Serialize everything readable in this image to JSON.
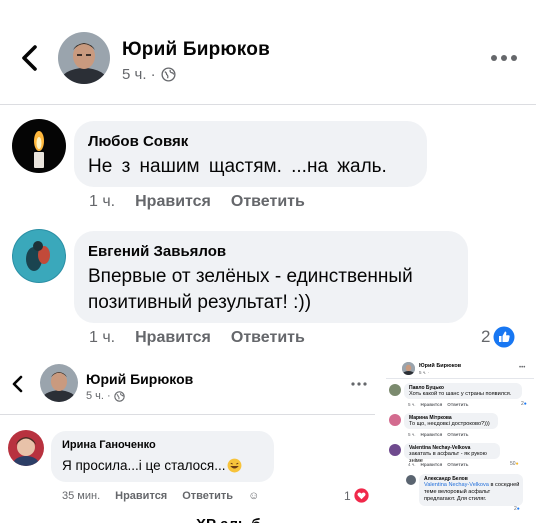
{
  "post": {
    "author": "Юрий Бирюков",
    "time": "5 ч. · "
  },
  "comments": [
    {
      "author": "Любов Совяк",
      "text": "Не з нашим щастям. ...на жаль.",
      "time": "1 ч.",
      "like": "Нравится",
      "reply": "Ответить"
    },
    {
      "author": "Евгений Завьялов",
      "text_line1": "Впервые от зелёных - единственный",
      "text_line2": "позитивный результат! :))",
      "time": "1 ч.",
      "like": "Нравится",
      "reply": "Ответить",
      "reactions": "2"
    }
  ],
  "small": {
    "author": "Юрий Бирюков",
    "time": "5 ч. · ",
    "comment": {
      "author": "Ирина Ганоченко",
      "text": "Я просила...і це сталося...",
      "time": "35 мин.",
      "like": "Нравится",
      "reply": "Ответить",
      "reactions": "1"
    }
  },
  "thumb": {
    "author": "Юрий Бирюков",
    "time": "5 ч. ·",
    "comments": [
      {
        "author": "Павло Буцько",
        "text": "Хоть какой то шанс у страны появился.",
        "time": "5 ч.",
        "like": "Нравится",
        "reply": "Ответить",
        "reactions": "2"
      },
      {
        "author": "Марина Мітркова",
        "text": "То що, неєдовєі достроково?)))",
        "time": "5 ч.",
        "like": "Нравится",
        "reply": "Ответить"
      },
      {
        "author": "Valentina Nechay-Velkova",
        "text": "закатать в асфальт - як рукою знiме",
        "time": "4 ч.",
        "like": "Нравится",
        "reply": "Ответить",
        "reactions": "50"
      },
      {
        "author": "Александр Белов",
        "mention": "Valentina Nechay-Velkova",
        "text": " в соседней теме велоровый асфальт предлагают. Для стиляг.",
        "time": "",
        "like": "",
        "reply": "",
        "reactions": "2"
      }
    ]
  },
  "caption": "ΧΡ аль б"
}
